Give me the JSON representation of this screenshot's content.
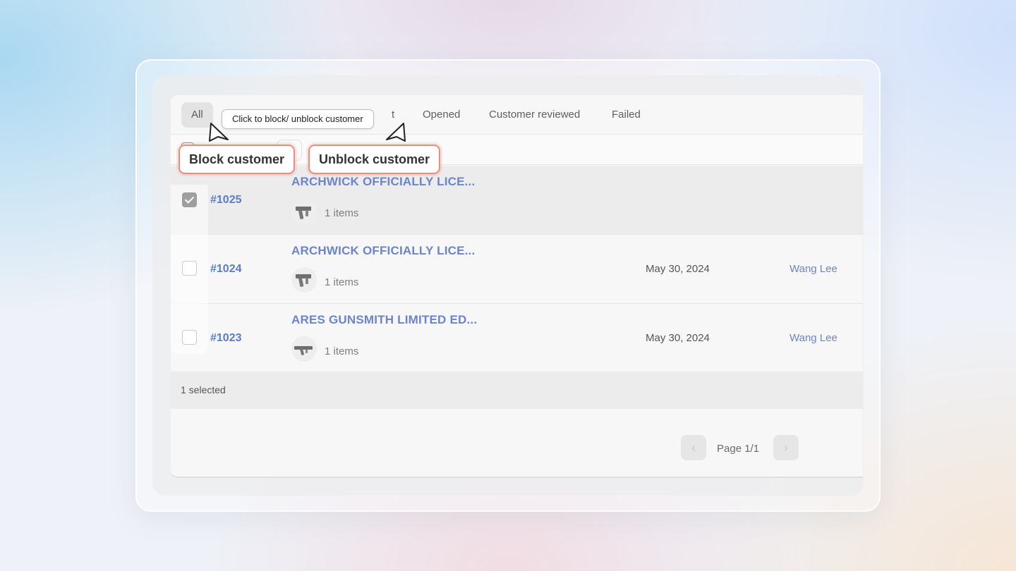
{
  "tabs": [
    {
      "label": "All"
    },
    {
      "label": "t"
    },
    {
      "label": "Opened"
    },
    {
      "label": "Customer reviewed"
    },
    {
      "label": "Failed"
    }
  ],
  "tooltip": {
    "text": "Click to block/ unblock customer"
  },
  "callouts": {
    "block": "Block customer",
    "unblock": "Unblock customer"
  },
  "orders": [
    {
      "id": "#1025",
      "product": "ARCHWICK OFFICIALLY LICE...",
      "items": "1 items",
      "date": "",
      "customer": "",
      "checked": true
    },
    {
      "id": "#1024",
      "product": "ARCHWICK OFFICIALLY LICE...",
      "items": "1 items",
      "date": "May 30, 2024",
      "customer": "Wang Lee",
      "checked": false
    },
    {
      "id": "#1023",
      "product": "ARES GUNSMITH LIMITED ED...",
      "items": "1 items",
      "date": "May 30, 2024",
      "customer": "Wang Lee",
      "checked": false
    }
  ],
  "footer": {
    "selected_text": "1 selected"
  },
  "pagination": {
    "label": "Page 1/1",
    "prev_icon": "chevron-left-icon",
    "next_icon": "chevron-right-icon"
  },
  "colors": {
    "accent_callout": "#ef8b7e",
    "link": "#6b84cc"
  }
}
